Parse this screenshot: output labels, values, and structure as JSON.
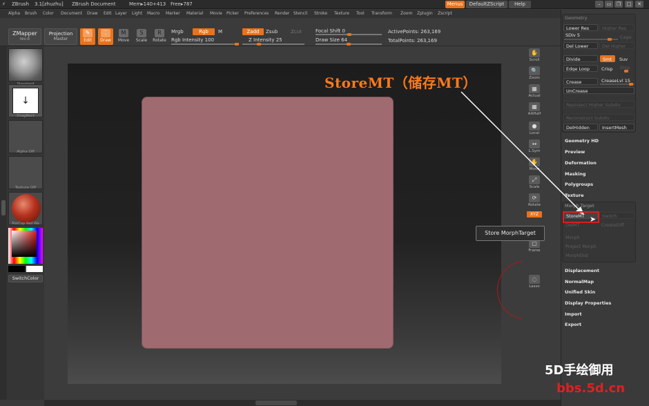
{
  "titlebar": {
    "app": "ZBrush",
    "version": "3.1[zhuzhu]",
    "document": "ZBrush Document",
    "mem": "Mem▸140+413",
    "free": "Free▸787",
    "menus_btn": "Menus",
    "script_btn": "DefaultZScript",
    "help_btn": "Help"
  },
  "menubar": [
    "Alpha",
    "Brush",
    "Color",
    "Document",
    "Draw",
    "Edit",
    "Layer",
    "Light",
    "Macro",
    "Marker",
    "Material",
    "Movie",
    "Picker",
    "Preferences",
    "Render",
    "Stencil",
    "Stroke",
    "Texture",
    "Tool",
    "Transform",
    "Zoom",
    "Zplugin",
    "Zscript"
  ],
  "toolbar": {
    "zmapper": "ZMapper",
    "zmapper_sub": "rev-E",
    "projection": "Projection",
    "projection_sub": "Master",
    "edit": "Edit",
    "draw": "Draw",
    "move": "Move",
    "scale": "Scale",
    "rotate": "Rotate",
    "mrgb": "Mrgb",
    "rgb": "Rgb",
    "m": "M",
    "rgb_intensity": "Rgb Intensity 100",
    "zadd": "Zadd",
    "zsub": "Zsub",
    "zcut": "Zcut",
    "z_intensity": "Z Intensity 25",
    "focal_shift": "Focal Shift 0",
    "draw_size": "Draw Size 64",
    "active_points": "ActivePoints: 263,169",
    "total_points": "TotalPoints: 263,169"
  },
  "leftpanel": {
    "standard": "Standard",
    "dragrect": "DragRect",
    "alpha_off": "Alpha Off",
    "texture_off": "Texture Off",
    "matcap": "MatCap Red Wa",
    "switchcolor": "SwitchColor"
  },
  "shelf": [
    "Scroll",
    "Zoom",
    "Actual",
    "AAHalf",
    "Local",
    "L.Sym",
    "Move",
    "Scale",
    "Rotate",
    "XYZ",
    "Frame",
    "Lasso"
  ],
  "geometry": {
    "title": "Geometry",
    "lower_res": "Lower Res",
    "higher_res": "Higher Res",
    "sdiv": "SDiv 5",
    "cage": "Cage",
    "del_lower": "Del Lower",
    "del_higher": "Del Higher",
    "divide": "Divide",
    "smt": "Smt",
    "suv": "Suv",
    "edge_loop": "Edge Loop",
    "crisp": "Crisp",
    "disp": "Disp",
    "crease": "Crease",
    "creaselvl": "CreaseLvl 15",
    "uncrease": "UnCrease",
    "reproject": "Reproject Higher Subdiv",
    "reconstruct": "Reconstruct Subdiv",
    "delhidden": "DelHidden",
    "insertmesh": "InsertMesh"
  },
  "menu_items": [
    "Geometry HD",
    "Preview",
    "Deformation",
    "Masking",
    "Polygroups",
    "Texture"
  ],
  "morph": {
    "title": "Morph Target",
    "storemt": "StoreMT",
    "switch": "Switch",
    "delmt": "DelMT",
    "creatediff": "CreateDiff",
    "morph": "Morph",
    "project_morph": "Project Morph",
    "morphdist": "MorphDist"
  },
  "menu_items2": [
    "Displacement",
    "NormalMap",
    "Unified Skin",
    "Display Properties",
    "Import",
    "Export"
  ],
  "annotation": {
    "title": "StoreMT（储存MT）",
    "tooltip": "Store MorphTarget"
  },
  "watermark": {
    "line1": "5D手绘御用",
    "line2": "bbs.5d.cn"
  }
}
